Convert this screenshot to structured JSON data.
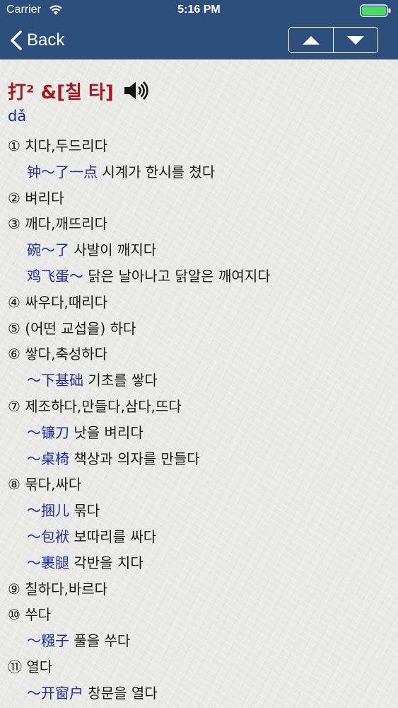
{
  "status_bar": {
    "carrier": "Carrier",
    "time": "5:16 PM"
  },
  "nav": {
    "back_label": "Back"
  },
  "entry": {
    "headword": "打² &[칠 타]",
    "pinyin": "dǎ",
    "lines": [
      {
        "type": "sense",
        "text": "① 치다,두드리다"
      },
      {
        "type": "example",
        "zh": "钟～了一点",
        "ko": " 시계가 한시를 쳤다"
      },
      {
        "type": "sense",
        "text": "② 벼리다"
      },
      {
        "type": "sense",
        "text": "③ 깨다,깨뜨리다"
      },
      {
        "type": "example",
        "zh": "碗～了",
        "ko": " 사발이 깨지다"
      },
      {
        "type": "example",
        "zh": "鸡飞蛋～",
        "ko": " 닭은 날아나고 닭알은 깨여지다"
      },
      {
        "type": "sense",
        "text": "④ 싸우다,때리다"
      },
      {
        "type": "sense",
        "text": "⑤ (어떤 교섭을) 하다"
      },
      {
        "type": "sense",
        "text": "⑥ 쌓다,축성하다"
      },
      {
        "type": "example",
        "zh": "～下基础",
        "ko": " 기초를 쌓다"
      },
      {
        "type": "sense",
        "text": "⑦ 제조하다,만들다,삼다,뜨다"
      },
      {
        "type": "example",
        "zh": "～镰刀",
        "ko": " 낫을 벼리다"
      },
      {
        "type": "example",
        "zh": "～桌椅",
        "ko": " 책상과 의자를 만들다"
      },
      {
        "type": "sense",
        "text": "⑧ 묶다,싸다"
      },
      {
        "type": "example",
        "zh": "～捆儿",
        "ko": " 묶다"
      },
      {
        "type": "example",
        "zh": "～包袱",
        "ko": " 보따리를 싸다"
      },
      {
        "type": "example",
        "zh": "～裹腿",
        "ko": " 각반을 치다"
      },
      {
        "type": "sense",
        "text": "⑨ 칠하다,바르다"
      },
      {
        "type": "sense",
        "text": "⑩ 쑤다"
      },
      {
        "type": "example",
        "zh": "～糨子",
        "ko": " 풀을 쑤다"
      },
      {
        "type": "sense",
        "text": "⑪ 열다"
      },
      {
        "type": "example",
        "zh": "～开窗户",
        "ko": " 창문을 열다"
      }
    ]
  },
  "colors": {
    "nav_background": "#2c4f7c",
    "headword": "#a01b1b",
    "chinese": "#1e2f9a",
    "battery": "#4cd964"
  },
  "icons": [
    "wifi-icon",
    "battery-icon",
    "chevron-left-icon",
    "arrow-up-icon",
    "arrow-down-icon",
    "speaker-icon"
  ]
}
